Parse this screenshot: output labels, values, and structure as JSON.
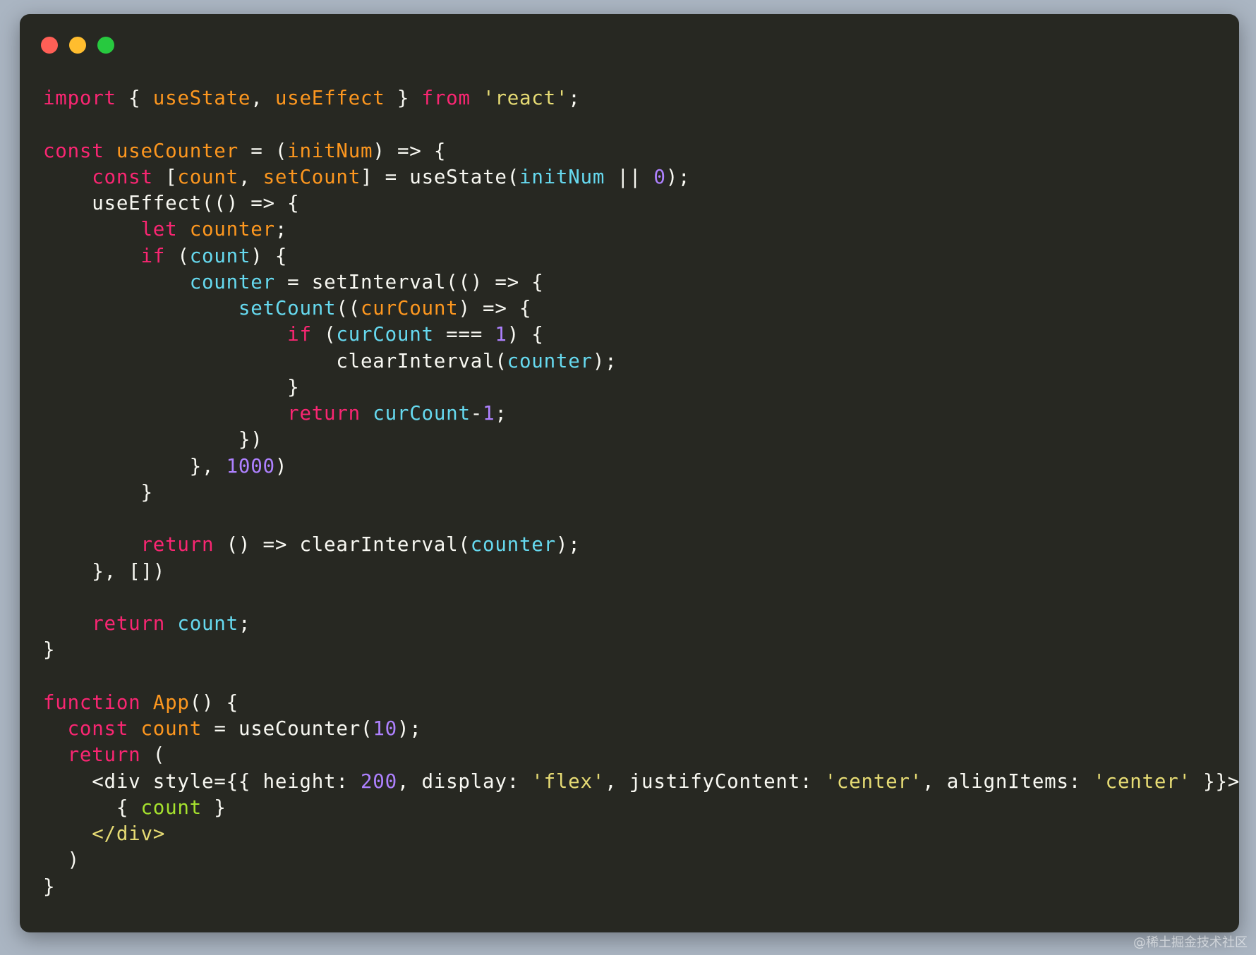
{
  "window": {
    "controls": {
      "close_color": "#ff5f56",
      "minimize_color": "#ffbd2e",
      "maximize_color": "#27c93f"
    }
  },
  "code": {
    "lines": [
      [
        [
          "keyword",
          "import"
        ],
        [
          "plain",
          " { "
        ],
        [
          "func",
          "useState"
        ],
        [
          "plain",
          ", "
        ],
        [
          "func",
          "useEffect"
        ],
        [
          "plain",
          " } "
        ],
        [
          "keyword",
          "from"
        ],
        [
          "plain",
          " "
        ],
        [
          "string",
          "'react'"
        ],
        [
          "plain",
          ";"
        ]
      ],
      [],
      [
        [
          "keyword",
          "const"
        ],
        [
          "plain",
          " "
        ],
        [
          "func",
          "useCounter"
        ],
        [
          "plain",
          " = ("
        ],
        [
          "func",
          "initNum"
        ],
        [
          "plain",
          ") => {"
        ]
      ],
      [
        [
          "plain",
          "    "
        ],
        [
          "keyword",
          "const"
        ],
        [
          "plain",
          " ["
        ],
        [
          "func",
          "count"
        ],
        [
          "plain",
          ", "
        ],
        [
          "func",
          "setCount"
        ],
        [
          "plain",
          "] = useState("
        ],
        [
          "var",
          "initNum"
        ],
        [
          "plain",
          " || "
        ],
        [
          "num",
          "0"
        ],
        [
          "plain",
          ");"
        ]
      ],
      [
        [
          "plain",
          "    useEffect(() => {"
        ]
      ],
      [
        [
          "plain",
          "        "
        ],
        [
          "keyword",
          "let"
        ],
        [
          "plain",
          " "
        ],
        [
          "func",
          "counter"
        ],
        [
          "plain",
          ";"
        ]
      ],
      [
        [
          "plain",
          "        "
        ],
        [
          "keyword",
          "if"
        ],
        [
          "plain",
          " ("
        ],
        [
          "var",
          "count"
        ],
        [
          "plain",
          ") {"
        ]
      ],
      [
        [
          "plain",
          "            "
        ],
        [
          "var",
          "counter"
        ],
        [
          "plain",
          " = setInterval(() => {"
        ]
      ],
      [
        [
          "plain",
          "                "
        ],
        [
          "var",
          "setCount"
        ],
        [
          "plain",
          "(("
        ],
        [
          "func",
          "curCount"
        ],
        [
          "plain",
          ") => {"
        ]
      ],
      [
        [
          "plain",
          "                    "
        ],
        [
          "keyword",
          "if"
        ],
        [
          "plain",
          " ("
        ],
        [
          "var",
          "curCount"
        ],
        [
          "plain",
          " === "
        ],
        [
          "num",
          "1"
        ],
        [
          "plain",
          ") {"
        ]
      ],
      [
        [
          "plain",
          "                        clearInterval("
        ],
        [
          "var",
          "counter"
        ],
        [
          "plain",
          ");"
        ]
      ],
      [
        [
          "plain",
          "                    }"
        ]
      ],
      [
        [
          "plain",
          "                    "
        ],
        [
          "keyword",
          "return"
        ],
        [
          "plain",
          " "
        ],
        [
          "var",
          "curCount"
        ],
        [
          "plain",
          "-"
        ],
        [
          "num",
          "1"
        ],
        [
          "plain",
          ";"
        ]
      ],
      [
        [
          "plain",
          "                })"
        ]
      ],
      [
        [
          "plain",
          "            }, "
        ],
        [
          "num",
          "1000"
        ],
        [
          "plain",
          ")"
        ]
      ],
      [
        [
          "plain",
          "        }"
        ]
      ],
      [],
      [
        [
          "plain",
          "        "
        ],
        [
          "keyword",
          "return"
        ],
        [
          "plain",
          " () => clearInterval("
        ],
        [
          "var",
          "counter"
        ],
        [
          "plain",
          ");"
        ]
      ],
      [
        [
          "plain",
          "    }, [])"
        ]
      ],
      [],
      [
        [
          "plain",
          "    "
        ],
        [
          "keyword",
          "return"
        ],
        [
          "plain",
          " "
        ],
        [
          "var",
          "count"
        ],
        [
          "plain",
          ";"
        ]
      ],
      [
        [
          "plain",
          "}"
        ]
      ],
      [],
      [
        [
          "keyword",
          "function"
        ],
        [
          "plain",
          " "
        ],
        [
          "func",
          "App"
        ],
        [
          "plain",
          "() {"
        ]
      ],
      [
        [
          "plain",
          "  "
        ],
        [
          "keyword",
          "const"
        ],
        [
          "plain",
          " "
        ],
        [
          "func",
          "count"
        ],
        [
          "plain",
          " = useCounter("
        ],
        [
          "num",
          "10"
        ],
        [
          "plain",
          ");"
        ]
      ],
      [
        [
          "plain",
          "  "
        ],
        [
          "keyword",
          "return"
        ],
        [
          "plain",
          " ("
        ]
      ],
      [
        [
          "plain",
          "    <div style={{ height: "
        ],
        [
          "num",
          "200"
        ],
        [
          "plain",
          ", display: "
        ],
        [
          "string",
          "'flex'"
        ],
        [
          "plain",
          ", justifyContent: "
        ],
        [
          "string",
          "'center'"
        ],
        [
          "plain",
          ", alignItems: "
        ],
        [
          "string",
          "'center'"
        ],
        [
          "plain",
          " }}>"
        ]
      ],
      [
        [
          "plain",
          "      { "
        ],
        [
          "green",
          "count"
        ],
        [
          "plain",
          " }"
        ]
      ],
      [
        [
          "plain",
          "    "
        ],
        [
          "tag",
          "</div>"
        ]
      ],
      [
        [
          "plain",
          "  )"
        ]
      ],
      [
        [
          "plain",
          "}"
        ]
      ]
    ]
  },
  "watermark": "@稀土掘金技术社区"
}
